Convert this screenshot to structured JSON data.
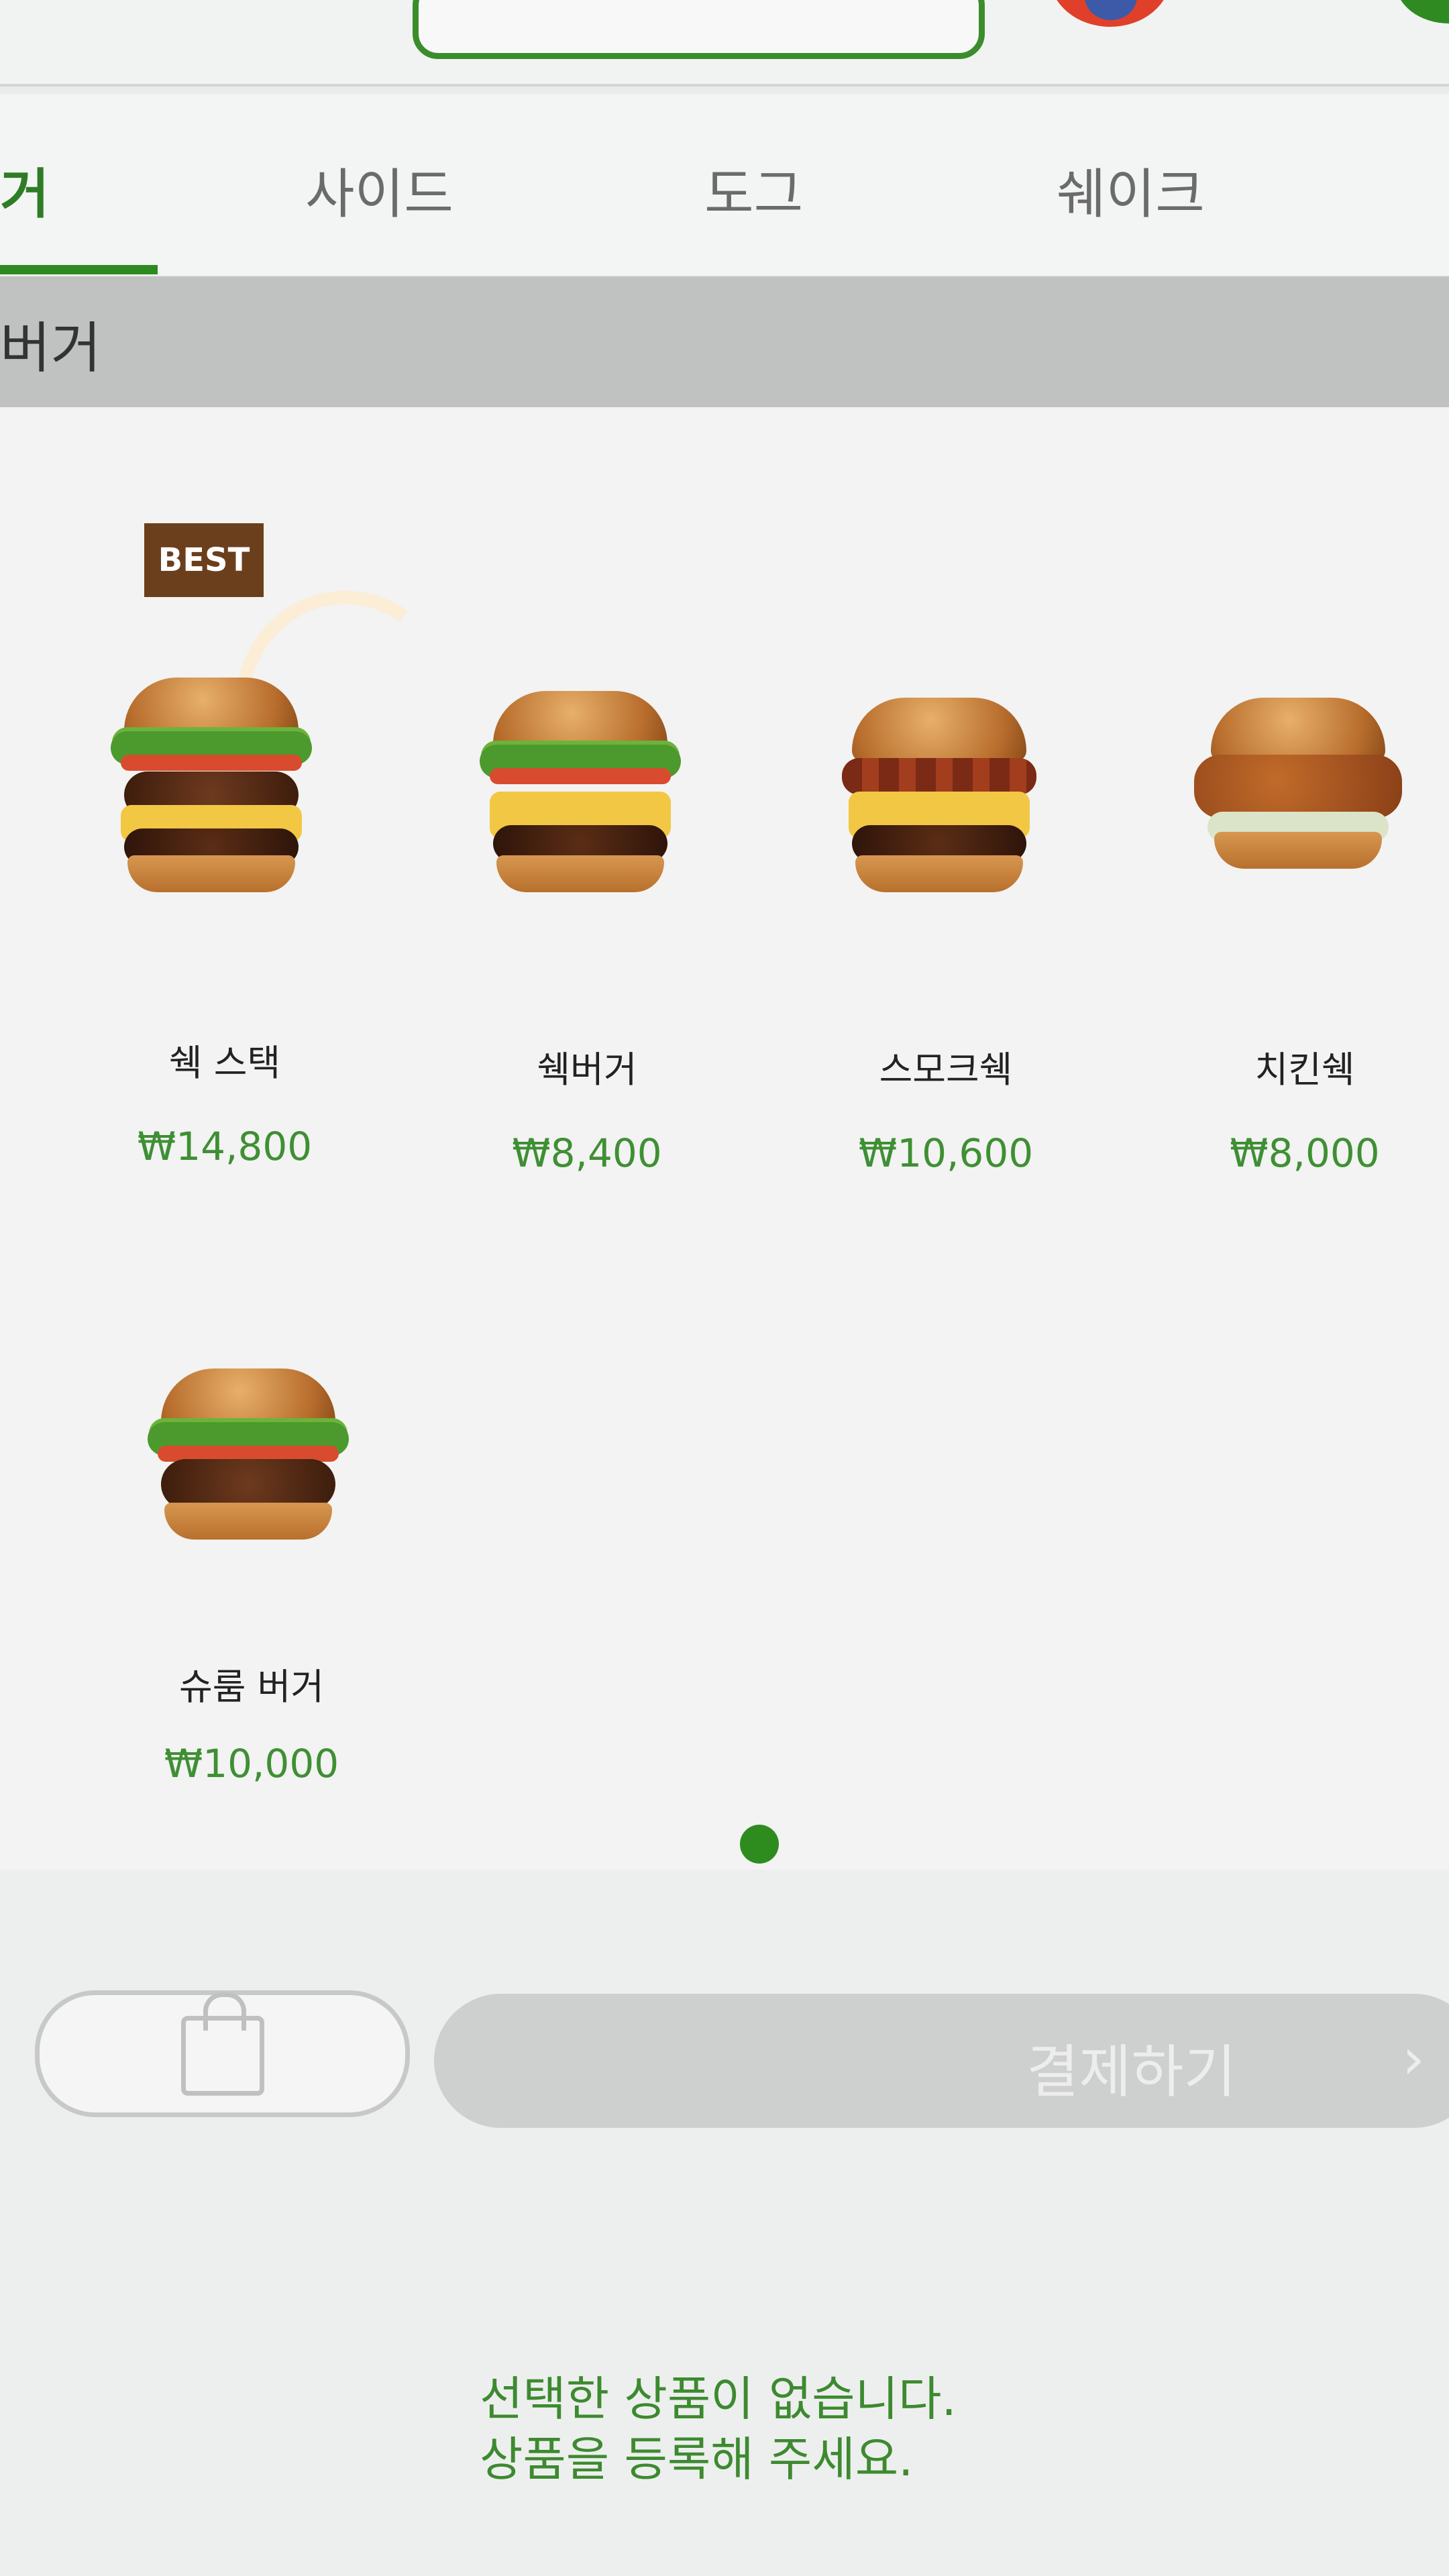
{
  "tabs": [
    {
      "label": "거",
      "active": true
    },
    {
      "label": "사이드",
      "active": false
    },
    {
      "label": "도그",
      "active": false
    },
    {
      "label": "쉐이크",
      "active": false
    }
  ],
  "section": {
    "title": "버거"
  },
  "badge": {
    "label": "BEST"
  },
  "products": [
    {
      "name": "쉑 스택",
      "price": "₩14,800",
      "badge": "BEST"
    },
    {
      "name": "쉑버거",
      "price": "₩8,400"
    },
    {
      "name": "스모크쉑",
      "price": "₩10,600"
    },
    {
      "name": "치킨쉑",
      "price": "₩8,000"
    },
    {
      "name": "슈룸 버거",
      "price": "₩10,000"
    }
  ],
  "pagination": {
    "current": 1,
    "total": 1
  },
  "cart": {
    "icon": "shopping-bag-icon"
  },
  "checkout": {
    "label": "결제하기",
    "chevron": "›"
  },
  "empty_message": {
    "line1": "선택한 상품이 없습니다.",
    "line2": "상품을 등록해 주세요."
  },
  "colors": {
    "accent": "#2d8a20",
    "price": "#3f8f34",
    "badge": "#6c3f1c"
  }
}
